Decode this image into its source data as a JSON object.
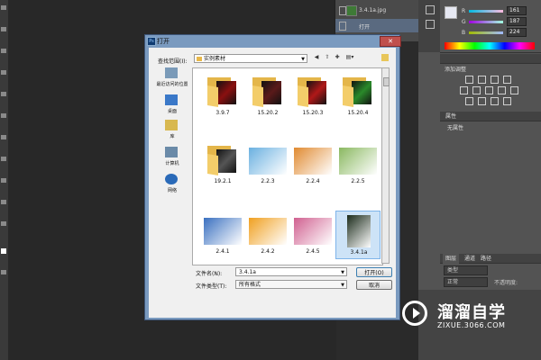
{
  "history": {
    "items": [
      {
        "label": "3.4.1a.jpg"
      },
      {
        "label": "打开"
      }
    ]
  },
  "color": {
    "r_label": "R",
    "r_value": "161",
    "g_label": "G",
    "g_value": "187",
    "b_label": "B",
    "b_value": "224",
    "fg_color": "#e6e8f2"
  },
  "adjust_panel": {
    "title": "添加调整"
  },
  "props_panel": {
    "tab": "属性",
    "text": "无属性"
  },
  "layers_panel": {
    "tabs": [
      "图层",
      "通道",
      "路径"
    ],
    "kind": "类型",
    "blend": "正常",
    "opacity_label": "不透明度:"
  },
  "dialog": {
    "title": "打开",
    "close": "✕",
    "look_in_label": "查找范围(I):",
    "look_in_value": "实例素材",
    "places": [
      {
        "label": "最近访问的位置"
      },
      {
        "label": "桌面"
      },
      {
        "label": "库"
      },
      {
        "label": "计算机"
      },
      {
        "label": "网络"
      }
    ],
    "files": [
      {
        "name": "3.9.7",
        "kind": "folder",
        "color": "#8a1010"
      },
      {
        "name": "15.20.2",
        "kind": "folder",
        "color": "#5a1a1a"
      },
      {
        "name": "15.20.3",
        "kind": "folder",
        "color": "#b01818"
      },
      {
        "name": "15.20.4",
        "kind": "folder",
        "color": "#2a8a2a"
      },
      {
        "name": "19.2.1",
        "kind": "folder",
        "color": "#555555"
      },
      {
        "name": "2.2.3",
        "kind": "image",
        "color": "#6ab0e0"
      },
      {
        "name": "2.2.4",
        "kind": "image",
        "color": "#e08a30"
      },
      {
        "name": "2.2.5",
        "kind": "image",
        "color": "#8ab860"
      },
      {
        "name": "2.4.1",
        "kind": "image",
        "color": "#3a70c0"
      },
      {
        "name": "2.4.2",
        "kind": "image",
        "color": "#f0a020"
      },
      {
        "name": "2.4.5",
        "kind": "image",
        "color": "#d06090"
      },
      {
        "name": "3.4.1a",
        "kind": "image",
        "color": "#1a2a1a",
        "selected": true
      }
    ],
    "filename_label": "文件名(N):",
    "filename_value": "3.4.1a",
    "filetype_label": "文件类型(T):",
    "filetype_value": "所有格式",
    "open_button": "打开(O)",
    "cancel_button": "取消"
  },
  "watermark": {
    "title": "溜溜自学",
    "url": "ZIXUE.3066.COM"
  }
}
